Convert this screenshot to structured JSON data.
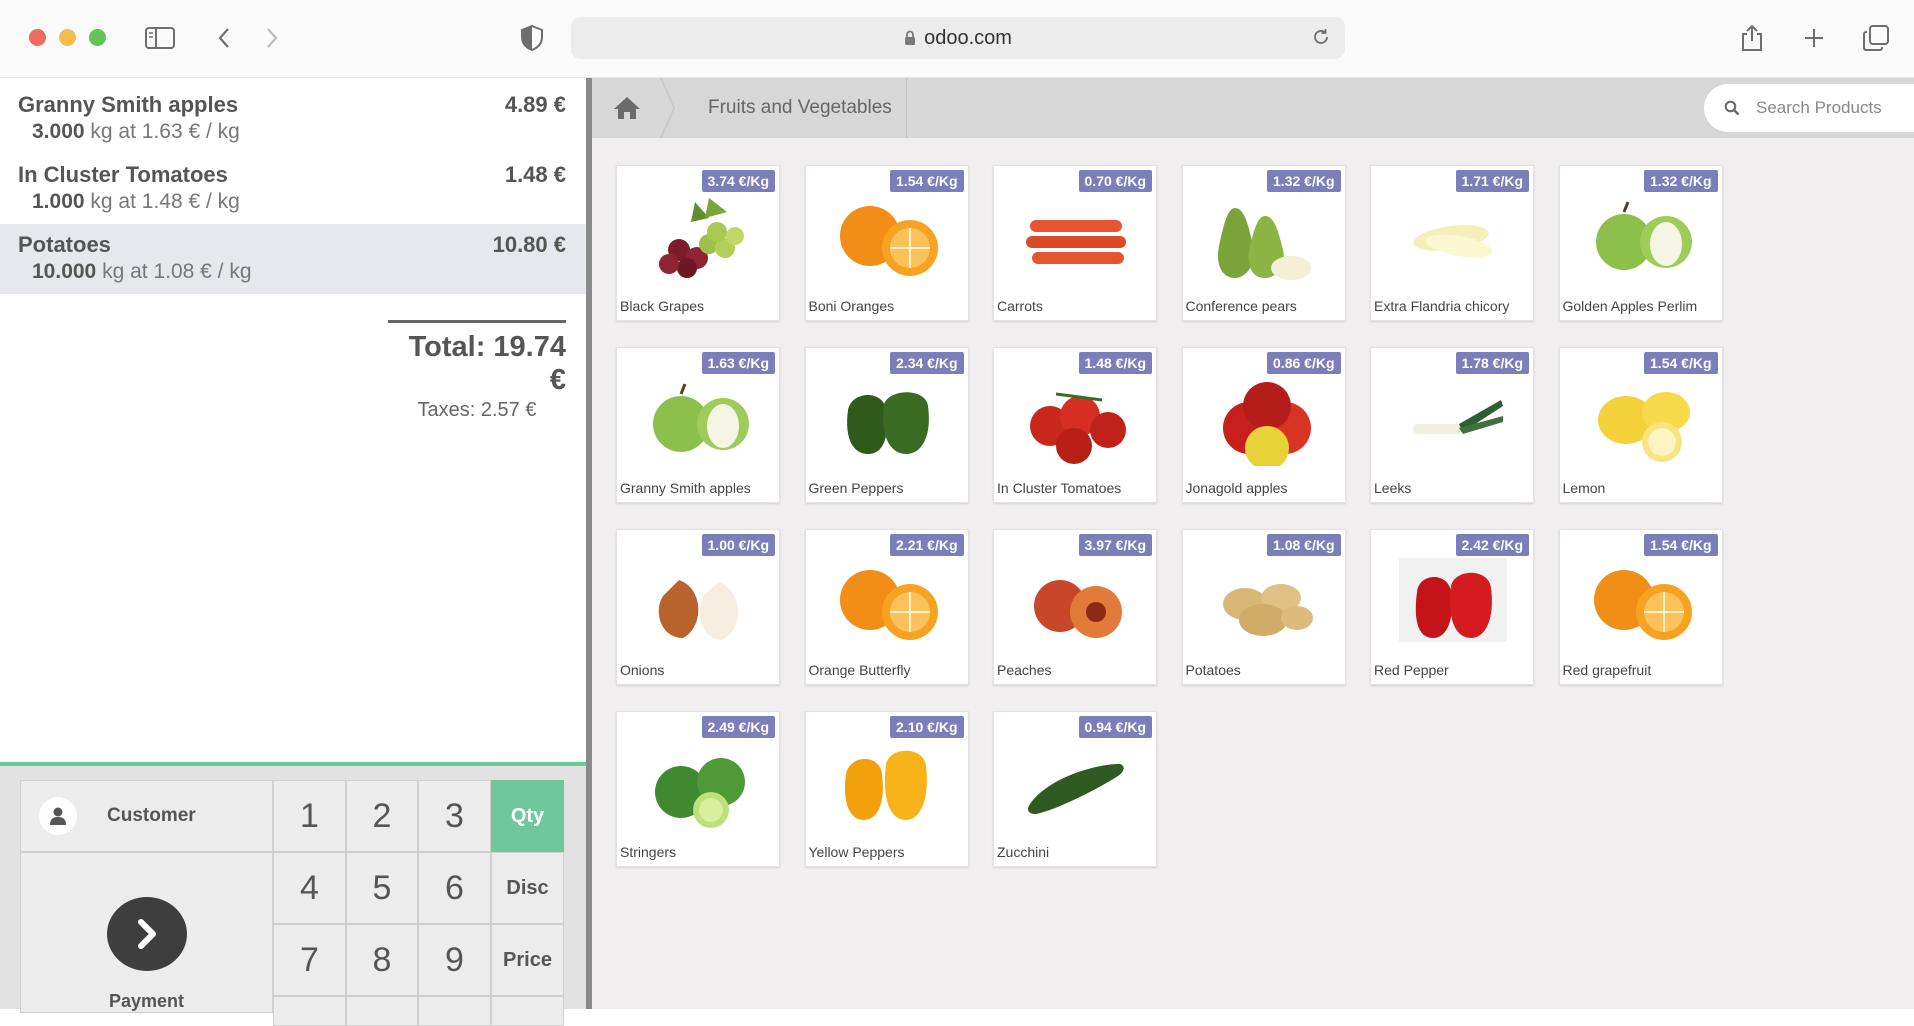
{
  "browser": {
    "url": "odoo.com"
  },
  "order": {
    "lines": [
      {
        "name": "Granny Smith apples",
        "price": "4.89 €",
        "qty": "3.000",
        "info": "kg at 1.63 € / kg",
        "selected": false
      },
      {
        "name": "In Cluster Tomatoes",
        "price": "1.48 €",
        "qty": "1.000",
        "info": "kg at 1.48 € / kg",
        "selected": false
      },
      {
        "name": "Potatoes",
        "price": "10.80 €",
        "qty": "10.000",
        "info": "kg at 1.08 € / kg",
        "selected": true
      }
    ],
    "total": "Total: 19.74 €",
    "taxes": "Taxes: 2.57 €"
  },
  "numpad": {
    "customer_label": "Customer",
    "payment_label": "Payment",
    "digits": [
      "1",
      "2",
      "3",
      "4",
      "5",
      "6",
      "7",
      "8",
      "9"
    ],
    "modes": [
      "Qty",
      "Disc",
      "Price"
    ],
    "active_mode": "Qty",
    "accent_color": "#6ec89b"
  },
  "products_header": {
    "breadcrumb": "Fruits and Vegetables",
    "search_placeholder": "Search Products"
  },
  "products": [
    {
      "name": "Black Grapes",
      "price": "3.74 €/Kg",
      "icon": "grapes"
    },
    {
      "name": "Boni Oranges",
      "price": "1.54 €/Kg",
      "icon": "orange"
    },
    {
      "name": "Carrots",
      "price": "0.70 €/Kg",
      "icon": "carrot"
    },
    {
      "name": "Conference pears",
      "price": "1.32 €/Kg",
      "icon": "pear"
    },
    {
      "name": "Extra Flandria chicory",
      "price": "1.71 €/Kg",
      "icon": "chicory"
    },
    {
      "name": "Golden Apples Perlim",
      "price": "1.32 €/Kg",
      "icon": "green-apple"
    },
    {
      "name": "Granny Smith apples",
      "price": "1.63 €/Kg",
      "icon": "green-apple"
    },
    {
      "name": "Green Peppers",
      "price": "2.34 €/Kg",
      "icon": "green-pepper"
    },
    {
      "name": "In Cluster Tomatoes",
      "price": "1.48 €/Kg",
      "icon": "tomato"
    },
    {
      "name": "Jonagold apples",
      "price": "0.86 €/Kg",
      "icon": "red-apple"
    },
    {
      "name": "Leeks",
      "price": "1.78 €/Kg",
      "icon": "leek"
    },
    {
      "name": "Lemon",
      "price": "1.54 €/Kg",
      "icon": "lemon"
    },
    {
      "name": "Onions",
      "price": "1.00 €/Kg",
      "icon": "onion"
    },
    {
      "name": "Orange Butterfly",
      "price": "2.21 €/Kg",
      "icon": "orange"
    },
    {
      "name": "Peaches",
      "price": "3.97 €/Kg",
      "icon": "peach"
    },
    {
      "name": "Potatoes",
      "price": "1.08 €/Kg",
      "icon": "potato"
    },
    {
      "name": "Red Pepper",
      "price": "2.42 €/Kg",
      "icon": "red-pepper"
    },
    {
      "name": "Red grapefruit",
      "price": "1.54 €/Kg",
      "icon": "orange"
    },
    {
      "name": "Stringers",
      "price": "2.49 €/Kg",
      "icon": "lime"
    },
    {
      "name": "Yellow Peppers",
      "price": "2.10 €/Kg",
      "icon": "yellow-pepper"
    },
    {
      "name": "Zucchini",
      "price": "0.94 €/Kg",
      "icon": "zucchini"
    }
  ],
  "colors": {
    "price_tag": "#7b7eb8",
    "selected_line": "#e6e8ee"
  }
}
